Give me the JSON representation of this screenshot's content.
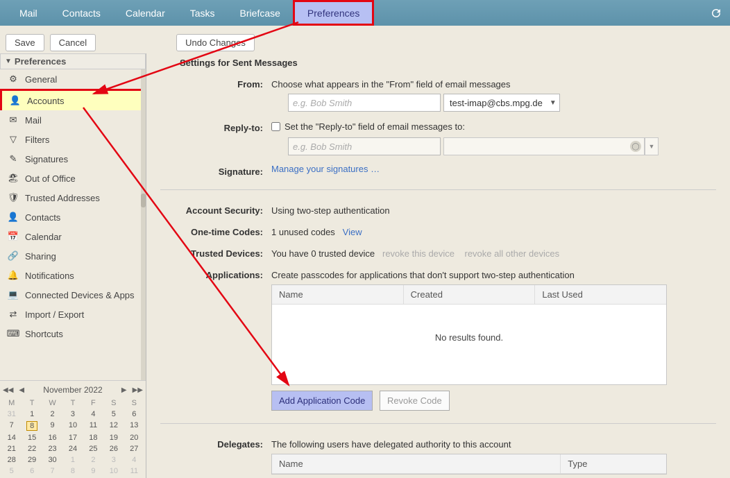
{
  "topnav": {
    "tabs": [
      "Mail",
      "Contacts",
      "Calendar",
      "Tasks",
      "Briefcase",
      "Preferences"
    ],
    "active_index": 5
  },
  "toolbar": {
    "save": "Save",
    "cancel": "Cancel",
    "undo": "Undo Changes"
  },
  "sidebar": {
    "header": "Preferences",
    "items": [
      {
        "label": "General"
      },
      {
        "label": "Accounts",
        "selected": true
      },
      {
        "label": "Mail"
      },
      {
        "label": "Filters"
      },
      {
        "label": "Signatures"
      },
      {
        "label": "Out of Office"
      },
      {
        "label": "Trusted Addresses"
      },
      {
        "label": "Contacts"
      },
      {
        "label": "Calendar"
      },
      {
        "label": "Sharing"
      },
      {
        "label": "Notifications"
      },
      {
        "label": "Connected Devices & Apps"
      },
      {
        "label": "Import / Export"
      },
      {
        "label": "Shortcuts"
      }
    ]
  },
  "calendar": {
    "title": "November 2022",
    "dow": [
      "M",
      "T",
      "W",
      "T",
      "F",
      "S",
      "S"
    ],
    "cells": [
      {
        "n": "31",
        "dim": true
      },
      {
        "n": "1"
      },
      {
        "n": "2"
      },
      {
        "n": "3"
      },
      {
        "n": "4"
      },
      {
        "n": "5"
      },
      {
        "n": "6"
      },
      {
        "n": "7"
      },
      {
        "n": "8",
        "today": true
      },
      {
        "n": "9"
      },
      {
        "n": "10"
      },
      {
        "n": "11"
      },
      {
        "n": "12"
      },
      {
        "n": "13"
      },
      {
        "n": "14"
      },
      {
        "n": "15"
      },
      {
        "n": "16"
      },
      {
        "n": "17"
      },
      {
        "n": "18"
      },
      {
        "n": "19"
      },
      {
        "n": "20"
      },
      {
        "n": "21"
      },
      {
        "n": "22"
      },
      {
        "n": "23"
      },
      {
        "n": "24"
      },
      {
        "n": "25"
      },
      {
        "n": "26"
      },
      {
        "n": "27"
      },
      {
        "n": "28"
      },
      {
        "n": "29"
      },
      {
        "n": "30"
      },
      {
        "n": "1",
        "dim": true
      },
      {
        "n": "2",
        "dim": true
      },
      {
        "n": "3",
        "dim": true
      },
      {
        "n": "4",
        "dim": true
      },
      {
        "n": "5",
        "dim": true
      },
      {
        "n": "6",
        "dim": true
      },
      {
        "n": "7",
        "dim": true
      },
      {
        "n": "8",
        "dim": true
      },
      {
        "n": "9",
        "dim": true
      },
      {
        "n": "10",
        "dim": true
      },
      {
        "n": "11",
        "dim": true
      }
    ]
  },
  "content": {
    "sent_header": "Settings for Sent Messages",
    "from_label": "From:",
    "from_desc": "Choose what appears in the \"From\" field of email messages",
    "from_name_placeholder": "e.g. Bob Smith",
    "from_email": "test-imap@cbs.mpg.de",
    "replyto_label": "Reply-to:",
    "replyto_desc": "Set the \"Reply-to\" field of email messages to:",
    "replyto_name_placeholder": "e.g. Bob Smith",
    "signature_label": "Signature:",
    "signature_link": "Manage your signatures …",
    "acct_sec_label": "Account Security:",
    "acct_sec_value": "Using two-step authentication",
    "otc_label": "One-time Codes:",
    "otc_value": "1 unused codes",
    "otc_view": "View",
    "td_label": "Trusted Devices:",
    "td_value": "You have 0 trusted device",
    "td_revoke_this": "revoke this device",
    "td_revoke_all": "revoke all other devices",
    "apps_label": "Applications:",
    "apps_desc": "Create passcodes for applications that don't support two-step authentication",
    "apps_cols": {
      "name": "Name",
      "created": "Created",
      "last": "Last Used"
    },
    "apps_empty": "No results found.",
    "add_app_code": "Add Application Code",
    "revoke_code": "Revoke Code",
    "delegates_label": "Delegates:",
    "delegates_desc": "The following users have delegated authority to this account",
    "delegates_cols": {
      "name": "Name",
      "type": "Type"
    }
  }
}
